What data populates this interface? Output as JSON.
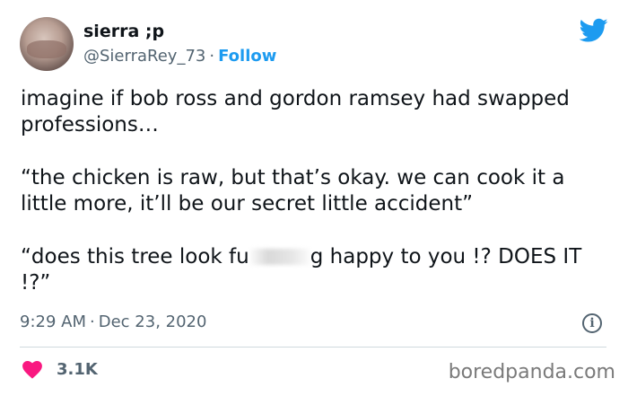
{
  "user": {
    "display_name": "sierra ;p",
    "handle": "@SierraRey_73",
    "separator": "·",
    "follow_label": "Follow"
  },
  "tweet": {
    "line1": "imagine if bob ross and gordon ramsey had swapped professions…",
    "line2": "“the chicken is raw, but that’s okay. we can cook it a little more, it’ll be our secret little accident”",
    "line3_before": "“does this tree look fu",
    "line3_after": "g happy to you !? DOES IT !?”"
  },
  "meta": {
    "time": "9:29 AM",
    "separator": "·",
    "date": "Dec 23, 2020",
    "likes": "3.1K"
  },
  "watermark": "boredpanda.com",
  "colors": {
    "twitter_blue": "#1d9bf0",
    "like_red": "#f91880",
    "secondary_text": "#536471"
  },
  "icons": [
    "twitter-bird-icon",
    "info-icon",
    "heart-icon"
  ]
}
